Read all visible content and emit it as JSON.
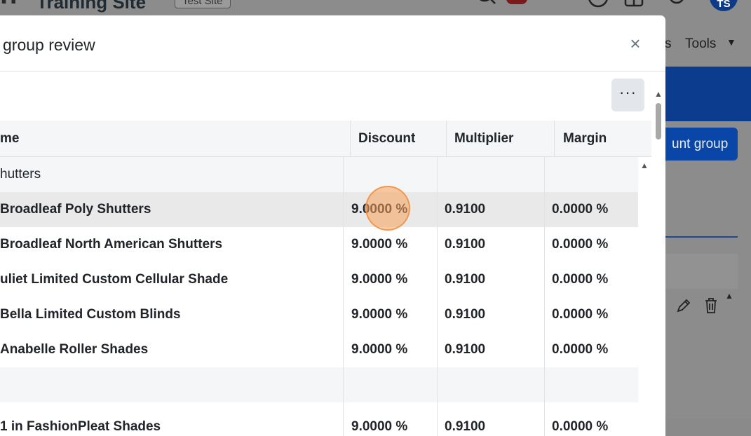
{
  "background": {
    "site_title": "Training Site",
    "badge": "Test Site",
    "nav_partial": "s",
    "nav_tools": "Tools",
    "button_partial": "unt group",
    "avatar_initials": "TS",
    "colors": {
      "primary": "#0a45a8",
      "overlay": "#8c8c8c"
    }
  },
  "modal": {
    "title": "group review",
    "close_label": "×",
    "more_label": "···",
    "columns": {
      "name": "me",
      "discount": "Discount",
      "multiplier": "Multiplier",
      "margin": "Margin"
    },
    "rows": [
      {
        "type": "group",
        "name": "hutters",
        "discount": "",
        "multiplier": "",
        "margin": ""
      },
      {
        "type": "item",
        "name": "Broadleaf Poly Shutters",
        "discount": "9.0000 %",
        "multiplier": "0.9100",
        "margin": "0.0000 %"
      },
      {
        "type": "item",
        "name": "Broadleaf North American Shutters",
        "discount": "9.0000 %",
        "multiplier": "0.9100",
        "margin": "0.0000 %"
      },
      {
        "type": "item",
        "name": "uliet Limited Custom Cellular Shade",
        "discount": "9.0000 %",
        "multiplier": "0.9100",
        "margin": "0.0000 %"
      },
      {
        "type": "item",
        "name": "Bella Limited Custom Blinds",
        "discount": "9.0000 %",
        "multiplier": "0.9100",
        "margin": "0.0000 %"
      },
      {
        "type": "item",
        "name": "Anabelle Roller Shades",
        "discount": "9.0000 %",
        "multiplier": "0.9100",
        "margin": "0.0000 %"
      },
      {
        "type": "group",
        "name": "",
        "discount": "",
        "multiplier": "",
        "margin": ""
      },
      {
        "type": "item",
        "name": "1 in FashionPleat Shades",
        "discount": "9.0000 %",
        "multiplier": "0.9100",
        "margin": "0.0000 %"
      }
    ]
  }
}
